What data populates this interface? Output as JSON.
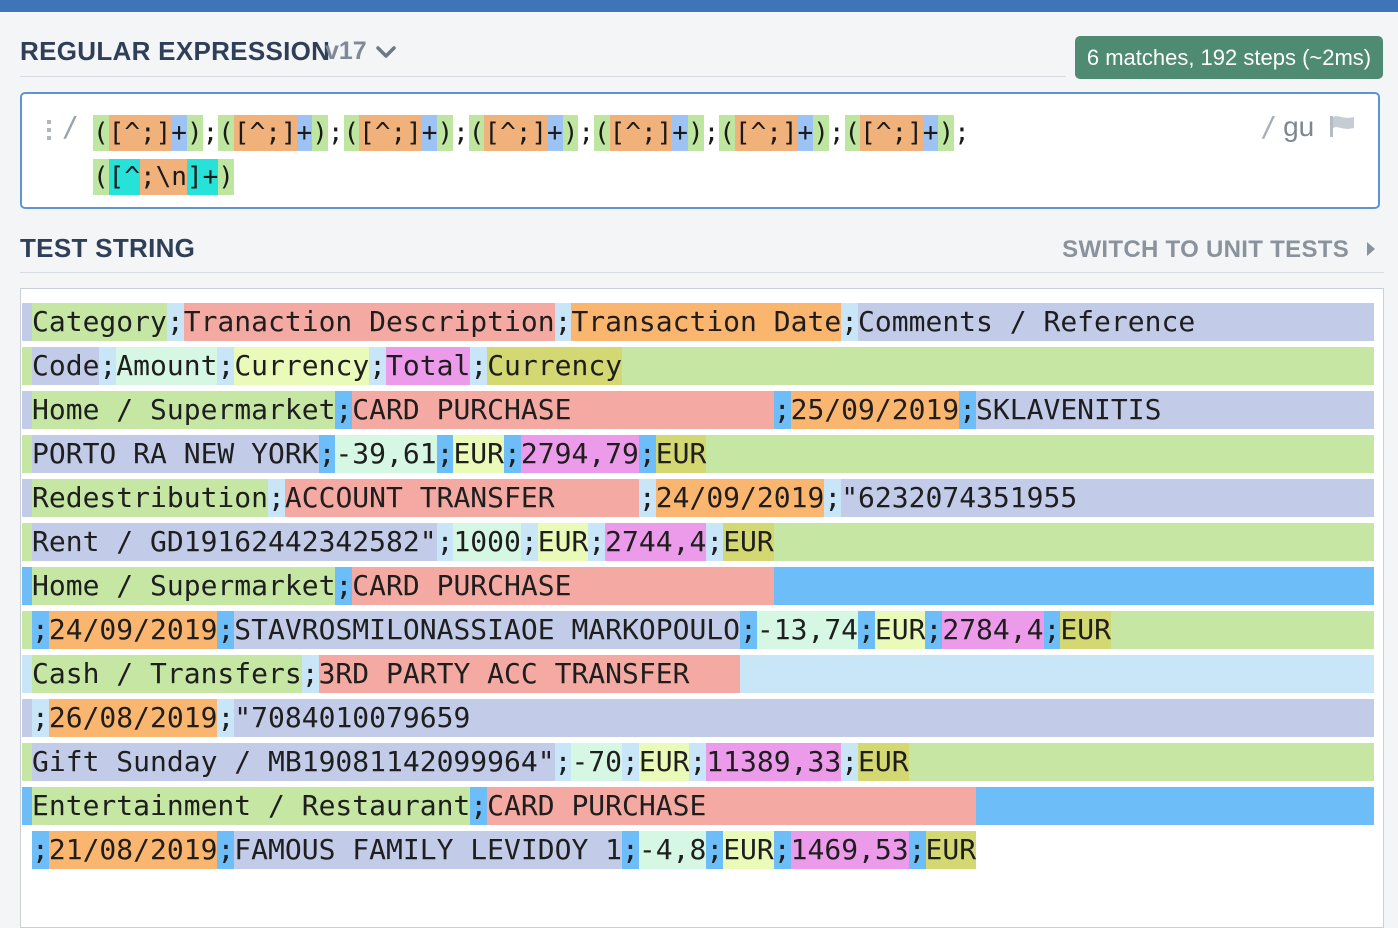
{
  "header": {
    "regex_title": "REGULAR EXPRESSION",
    "version": "v17",
    "match_badge": "6 matches, 192 steps (~2ms)"
  },
  "regex": {
    "open_delimiter": "/",
    "close_delimiter": "/",
    "flags": "gu",
    "lines": [
      [
        {
          "t": "(",
          "c": "grp"
        },
        {
          "t": "[",
          "c": "cls"
        },
        {
          "t": "^;",
          "c": "cls"
        },
        {
          "t": "]",
          "c": "cls"
        },
        {
          "t": "+",
          "c": "qty"
        },
        {
          "t": ")",
          "c": "grp"
        },
        {
          "t": ";",
          "c": "lit"
        },
        {
          "t": "(",
          "c": "grp"
        },
        {
          "t": "[",
          "c": "cls"
        },
        {
          "t": "^;",
          "c": "cls"
        },
        {
          "t": "]",
          "c": "cls"
        },
        {
          "t": "+",
          "c": "qty"
        },
        {
          "t": ")",
          "c": "grp"
        },
        {
          "t": ";",
          "c": "lit"
        },
        {
          "t": "(",
          "c": "grp"
        },
        {
          "t": "[",
          "c": "cls"
        },
        {
          "t": "^;",
          "c": "cls"
        },
        {
          "t": "]",
          "c": "cls"
        },
        {
          "t": "+",
          "c": "qty"
        },
        {
          "t": ")",
          "c": "grp"
        },
        {
          "t": ";",
          "c": "lit"
        },
        {
          "t": "(",
          "c": "grp"
        },
        {
          "t": "[",
          "c": "cls"
        },
        {
          "t": "^;",
          "c": "cls"
        },
        {
          "t": "]",
          "c": "cls"
        },
        {
          "t": "+",
          "c": "qty"
        },
        {
          "t": ")",
          "c": "grp"
        },
        {
          "t": ";",
          "c": "lit"
        },
        {
          "t": "(",
          "c": "grp"
        },
        {
          "t": "[",
          "c": "cls"
        },
        {
          "t": "^;",
          "c": "cls"
        },
        {
          "t": "]",
          "c": "cls"
        },
        {
          "t": "+",
          "c": "qty"
        },
        {
          "t": ")",
          "c": "grp"
        },
        {
          "t": ";",
          "c": "lit"
        },
        {
          "t": "(",
          "c": "grp"
        },
        {
          "t": "[",
          "c": "cls"
        },
        {
          "t": "^;",
          "c": "cls"
        },
        {
          "t": "]",
          "c": "cls"
        },
        {
          "t": "+",
          "c": "qty"
        },
        {
          "t": ")",
          "c": "grp"
        },
        {
          "t": ";",
          "c": "lit"
        },
        {
          "t": "(",
          "c": "grp"
        },
        {
          "t": "[",
          "c": "cls"
        },
        {
          "t": "^;",
          "c": "cls"
        },
        {
          "t": "]",
          "c": "cls"
        },
        {
          "t": "+",
          "c": "qty"
        },
        {
          "t": ")",
          "c": "grp"
        },
        {
          "t": ";",
          "c": "lit"
        }
      ],
      [
        {
          "t": "(",
          "c": "grp"
        },
        {
          "t": "[",
          "c": "cls2"
        },
        {
          "t": "^",
          "c": "cls2"
        },
        {
          "t": ";",
          "c": "cls"
        },
        {
          "t": "\\n",
          "c": "cls"
        },
        {
          "t": "]",
          "c": "cls2"
        },
        {
          "t": "+",
          "c": "cls2"
        },
        {
          "t": ")",
          "c": "grp"
        }
      ]
    ]
  },
  "test_string": {
    "title": "TEST STRING",
    "switch_label": "SWITCH TO UNIT TESTS",
    "lines": [
      {
        "fill": "lav",
        "segs": [
          {
            "t": "Category",
            "c": "g1"
          },
          {
            "t": ";",
            "c": "s1"
          },
          {
            "t": "Tranaction Description",
            "c": "g2"
          },
          {
            "t": ";",
            "c": "s1"
          },
          {
            "t": "Transaction Date",
            "c": "g3"
          },
          {
            "t": ";",
            "c": "s1"
          },
          {
            "t": "Comments / Reference",
            "c": "g4"
          }
        ]
      },
      {
        "fill": "g1",
        "segs": [
          {
            "t": "Code",
            "c": "g4"
          },
          {
            "t": ";",
            "c": "s1"
          },
          {
            "t": "Amount",
            "c": "g5"
          },
          {
            "t": ";",
            "c": "s1"
          },
          {
            "t": "Currency",
            "c": "g6"
          },
          {
            "t": ";",
            "c": "s1"
          },
          {
            "t": "Total",
            "c": "g7"
          },
          {
            "t": ";",
            "c": "s1"
          },
          {
            "t": "Currency",
            "c": "g8"
          }
        ]
      },
      {
        "fill": "lav",
        "segs": [
          {
            "t": "Home / Supermarket",
            "c": "g1"
          },
          {
            "t": ";",
            "c": "s2"
          },
          {
            "t": "CARD PURCHASE            ",
            "c": "g2"
          },
          {
            "t": ";",
            "c": "s2"
          },
          {
            "t": "25/09/2019",
            "c": "g3"
          },
          {
            "t": ";",
            "c": "s2"
          },
          {
            "t": "SKLAVENITIS",
            "c": "g4"
          }
        ]
      },
      {
        "fill": "g1",
        "segs": [
          {
            "t": "PORTO RA NEW YORK",
            "c": "g4"
          },
          {
            "t": ";",
            "c": "s2"
          },
          {
            "t": "-39,61",
            "c": "g5"
          },
          {
            "t": ";",
            "c": "s2"
          },
          {
            "t": "EUR",
            "c": "g6"
          },
          {
            "t": ";",
            "c": "s2"
          },
          {
            "t": "2794,79",
            "c": "g7"
          },
          {
            "t": ";",
            "c": "s2"
          },
          {
            "t": "EUR",
            "c": "g8"
          }
        ]
      },
      {
        "fill": "lav",
        "segs": [
          {
            "t": "Redestribution",
            "c": "g1"
          },
          {
            "t": ";",
            "c": "s1"
          },
          {
            "t": "ACCOUNT TRANSFER     ",
            "c": "g2"
          },
          {
            "t": ";",
            "c": "s1"
          },
          {
            "t": "24/09/2019",
            "c": "g3"
          },
          {
            "t": ";",
            "c": "s1"
          },
          {
            "t": "\"6232074351955",
            "c": "g4"
          }
        ]
      },
      {
        "fill": "g1",
        "segs": [
          {
            "t": "Rent / GD19162442342582\"",
            "c": "g4"
          },
          {
            "t": ";",
            "c": "s1"
          },
          {
            "t": "1000",
            "c": "g5"
          },
          {
            "t": ";",
            "c": "s1"
          },
          {
            "t": "EUR",
            "c": "g6"
          },
          {
            "t": ";",
            "c": "s1"
          },
          {
            "t": "2744,4",
            "c": "g7"
          },
          {
            "t": ";",
            "c": "s1"
          },
          {
            "t": "EUR",
            "c": "g8"
          }
        ]
      },
      {
        "fill": "blue",
        "segs": [
          {
            "t": "Home / Supermarket",
            "c": "g1"
          },
          {
            "t": ";",
            "c": "s2"
          },
          {
            "t": "CARD PURCHASE            ",
            "c": "g2"
          }
        ]
      },
      {
        "fill": "g1",
        "segs": [
          {
            "t": ";",
            "c": "s2"
          },
          {
            "t": "24/09/2019",
            "c": "g3"
          },
          {
            "t": ";",
            "c": "s2"
          },
          {
            "t": "STAVROSMILONASSIAOE MARKOPOULO",
            "c": "g4"
          },
          {
            "t": ";",
            "c": "s2"
          },
          {
            "t": "-13,74",
            "c": "g5"
          },
          {
            "t": ";",
            "c": "s2"
          },
          {
            "t": "EUR",
            "c": "g6"
          },
          {
            "t": ";",
            "c": "s2"
          },
          {
            "t": "2784,4",
            "c": "g7"
          },
          {
            "t": ";",
            "c": "s2"
          },
          {
            "t": "EUR",
            "c": "g8"
          }
        ]
      },
      {
        "fill": "lblue",
        "segs": [
          {
            "t": "Cash / Transfers",
            "c": "g1"
          },
          {
            "t": ";",
            "c": "s1"
          },
          {
            "t": "3RD PARTY ACC TRANSFER   ",
            "c": "g2"
          }
        ]
      },
      {
        "fill": "lav",
        "segs": [
          {
            "t": ";",
            "c": "s1"
          },
          {
            "t": "26/08/2019",
            "c": "g3"
          },
          {
            "t": ";",
            "c": "s1"
          },
          {
            "t": "\"7084010079659",
            "c": "g4"
          }
        ]
      },
      {
        "fill": "g1",
        "segs": [
          {
            "t": "Gift Sunday / MB19081142099964\"",
            "c": "g4"
          },
          {
            "t": ";",
            "c": "s1"
          },
          {
            "t": "-70",
            "c": "g5"
          },
          {
            "t": ";",
            "c": "s1"
          },
          {
            "t": "EUR",
            "c": "g6"
          },
          {
            "t": ";",
            "c": "s1"
          },
          {
            "t": "11389,33",
            "c": "g7"
          },
          {
            "t": ";",
            "c": "s1"
          },
          {
            "t": "EUR",
            "c": "g8"
          }
        ]
      },
      {
        "fill": "blue",
        "segs": [
          {
            "t": "Entertainment / Restaurant",
            "c": "g1"
          },
          {
            "t": ";",
            "c": "s2"
          },
          {
            "t": "CARD PURCHASE                ",
            "c": "g2"
          }
        ]
      },
      {
        "fill": "none",
        "segs": [
          {
            "t": ";",
            "c": "s2"
          },
          {
            "t": "21/08/2019",
            "c": "g3"
          },
          {
            "t": ";",
            "c": "s2"
          },
          {
            "t": "FAMOUS FAMILY LEVIDOY 1",
            "c": "g4"
          },
          {
            "t": ";",
            "c": "s2"
          },
          {
            "t": "-4,8",
            "c": "g5"
          },
          {
            "t": ";",
            "c": "s2"
          },
          {
            "t": "EUR",
            "c": "g6"
          },
          {
            "t": ";",
            "c": "s2"
          },
          {
            "t": "1469,53",
            "c": "g7"
          },
          {
            "t": ";",
            "c": "s2"
          },
          {
            "t": "EUR",
            "c": "g8"
          }
        ]
      }
    ]
  },
  "colors": {
    "grp": "#bfe6a0",
    "cls": "#f0b27a",
    "cls2": "#27e2d8",
    "qty": "#9dc3f5",
    "lit": "transparent",
    "g1": "#c6e6a4",
    "g2": "#f4aaa2",
    "g3": "#fab56e",
    "g4": "#c2cbe8",
    "g5": "#d6f7e4",
    "g6": "#eafab8",
    "g7": "#ec9aea",
    "g8": "#d3d872",
    "s1": "#c9e5f8",
    "s2": "#6dbdf8",
    "lav": "#c2cbe8",
    "blue": "#6dbdf8",
    "lblue": "#c9e5f8",
    "none": "transparent"
  }
}
